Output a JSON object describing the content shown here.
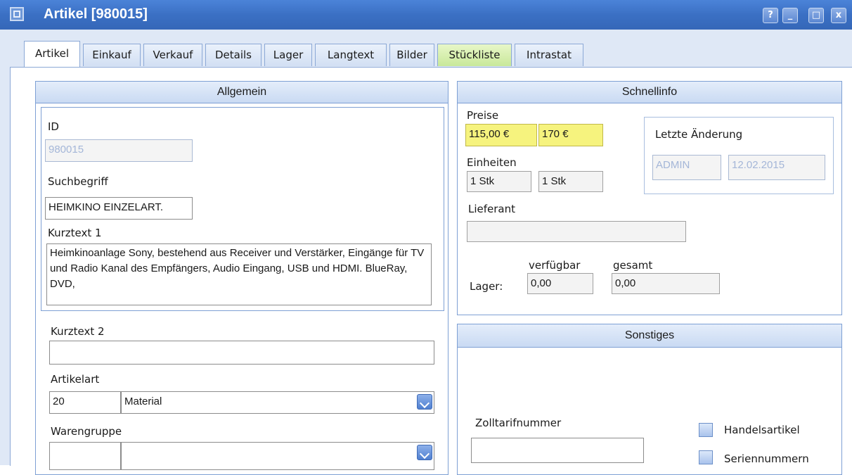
{
  "window": {
    "title": "Artikel [980015]",
    "buttons": [
      "?",
      "_",
      "□",
      "x"
    ]
  },
  "tabs": [
    {
      "label": "Artikel",
      "active": true
    },
    {
      "label": "Einkauf"
    },
    {
      "label": "Verkauf"
    },
    {
      "label": "Details"
    },
    {
      "label": "Lager"
    },
    {
      "label": "Langtext"
    },
    {
      "label": "Bilder"
    },
    {
      "label": "Stückliste",
      "highlight": true
    },
    {
      "label": "Intrastat"
    }
  ],
  "allgemein": {
    "header": "Allgemein",
    "id_label": "ID",
    "id_value": "980015",
    "suchbegriff_label": "Suchbegriff",
    "suchbegriff_value": "HEIMKINO EINZELART.",
    "kurztext1_label": "Kurztext 1",
    "kurztext1_value": "Heimkinoanlage Sony, bestehend aus Receiver und Verstärker, Eingänge für TV und Radio Kanal des Empfängers, Audio Eingang, USB und HDMI. BlueRay, DVD,",
    "kurztext2_label": "Kurztext 2",
    "kurztext2_value": "",
    "artikelart_label": "Artikelart",
    "artikelart_code": "20",
    "artikelart_value": "Material",
    "warengruppe_label": "Warengruppe",
    "warengruppe_code": "",
    "warengruppe_value": ""
  },
  "schnellinfo": {
    "header": "Schnellinfo",
    "preise_label": "Preise",
    "preis1": "115,00 €",
    "preis2": "170 €",
    "einheiten_label": "Einheiten",
    "einheit1": "1 Stk",
    "einheit2": "1 Stk",
    "lieferant_label": "Lieferant",
    "lieferant_value": "",
    "verfuegbar_label": "verfügbar",
    "gesamt_label": "gesamt",
    "lager_label": "Lager:",
    "lager_verfuegbar": "0,00",
    "lager_gesamt": "0,00",
    "letzte_aenderung_label": "Letzte Änderung",
    "letzte_user": "ADMIN",
    "letzte_datum": "12.02.2015"
  },
  "sonstiges": {
    "header": "Sonstiges",
    "zolltarif_label": "Zolltarifnummer",
    "zolltarif_value": "",
    "handelsartikel_label": "Handelsartikel",
    "seriennummern_label": "Seriennummern"
  },
  "colors": {
    "titlebar": "#3b70c4",
    "price_highlight": "#f6f37e",
    "tab_highlight": "#c8e89a"
  }
}
